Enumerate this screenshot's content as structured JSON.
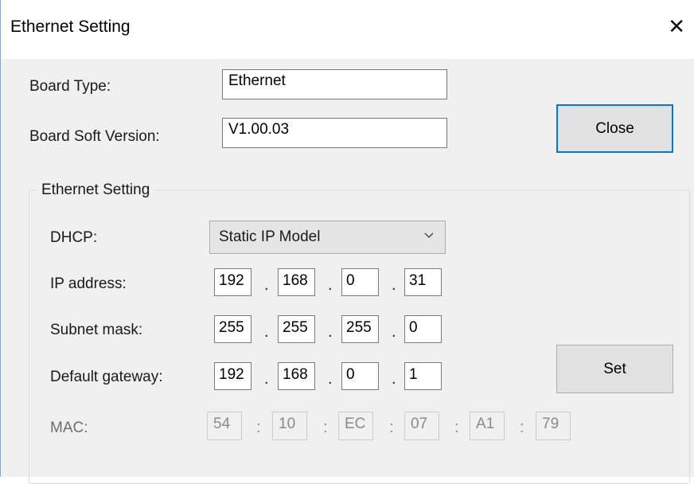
{
  "window": {
    "title": "Ethernet Setting",
    "close_glyph": "✕"
  },
  "board": {
    "type_label": "Board Type:",
    "type_value": "Ethernet",
    "version_label": "Board Soft Version:",
    "version_value": "V1.00.03"
  },
  "buttons": {
    "close_label": "Close",
    "set_label": "Set"
  },
  "group": {
    "title": "Ethernet Setting",
    "dhcp_label": "DHCP:",
    "dhcp_selected": "Static IP Model",
    "ip_label": "IP address:",
    "ip": [
      "192",
      "168",
      "0",
      "31"
    ],
    "mask_label": "Subnet mask:",
    "mask": [
      "255",
      "255",
      "255",
      "0"
    ],
    "gateway_label": "Default gateway:",
    "gateway": [
      "192",
      "168",
      "0",
      "1"
    ],
    "mac_label": "MAC:",
    "mac": [
      "54",
      "10",
      "EC",
      "07",
      "A1",
      "79"
    ],
    "ip_sep": ".",
    "mac_sep": ":"
  },
  "icons": {
    "close": "close-icon",
    "dropdown": "chevron-down-icon"
  },
  "colors": {
    "focus_border": "#0078d7",
    "window_bg": "#f0f0f0",
    "title_bg": "#ffffff"
  }
}
